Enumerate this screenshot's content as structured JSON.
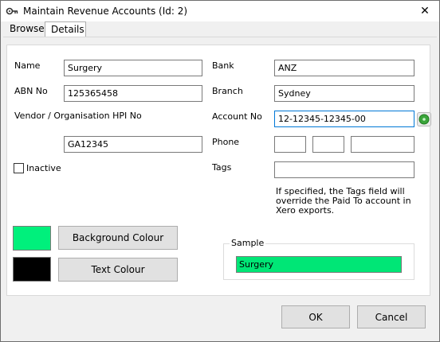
{
  "window": {
    "title": "Maintain Revenue Accounts (Id: 2)",
    "close_glyph": "✕"
  },
  "tabs": [
    {
      "label": "Browse",
      "selected": false
    },
    {
      "label": "Details",
      "selected": true
    }
  ],
  "form": {
    "name": {
      "label": "Name",
      "value": "Surgery"
    },
    "abn": {
      "label": "ABN No",
      "value": "125365458"
    },
    "vendor_hpi": {
      "label": "Vendor / Organisation HPI No",
      "value": "GA12345"
    },
    "inactive": {
      "label": "Inactive",
      "checked": false
    },
    "bank": {
      "label": "Bank",
      "value": "ANZ"
    },
    "branch": {
      "label": "Branch",
      "value": "Sydney"
    },
    "account_no": {
      "label": "Account No",
      "value": "12-12345-12345-00"
    },
    "phone": {
      "label": "Phone",
      "part1": "",
      "part2": "",
      "part3": ""
    },
    "tags": {
      "label": "Tags",
      "value": ""
    },
    "tags_note": "If specified, the Tags field will override the Paid To account in Xero exports."
  },
  "colours": {
    "background_button": "Background Colour",
    "text_button": "Text Colour",
    "background_swatch": "#00f07c",
    "text_swatch": "#000000"
  },
  "sample": {
    "group_title": "Sample",
    "text": "Surgery",
    "background": "#00e676",
    "text_color": "#000000"
  },
  "footer": {
    "ok": "OK",
    "cancel": "Cancel"
  },
  "icons": {
    "app": "key-icon",
    "close": "close-icon",
    "validate": "green-circle-icon"
  }
}
